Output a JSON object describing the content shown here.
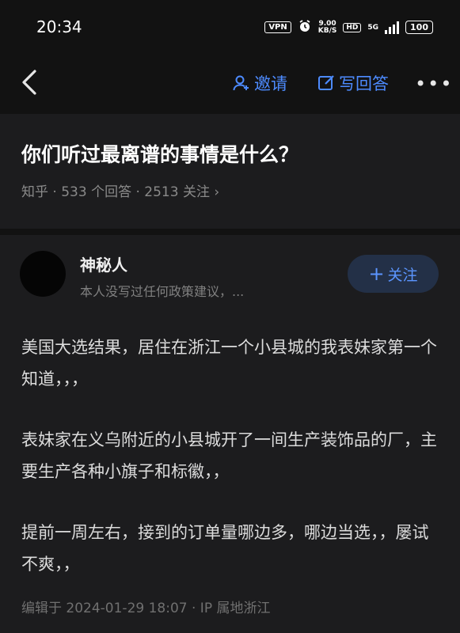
{
  "status_bar": {
    "time": "20:34",
    "vpn": "VPN",
    "speed_value": "9.00",
    "speed_unit": "KB/S",
    "hd": "HD",
    "network": "5G",
    "battery": "100"
  },
  "nav": {
    "invite_label": "邀请",
    "write_answer_label": "写回答",
    "more_label": "•••"
  },
  "question": {
    "title": "你们听过最离谱的事情是什么？",
    "meta": "知乎 · 533 个回答 · 2513 关注 ›"
  },
  "answer": {
    "author_name": "神秘人",
    "author_bio": "本人没写过任何政策建议，...",
    "follow_label": "关注",
    "paragraphs": [
      "美国大选结果，居住在浙江一个小县城的我表妹家第一个知道，，，",
      "表妹家在义乌附近的小县城开了一间生产装饰品的厂，主要生产各种小旗子和标徽，，",
      "提前一周左右，接到的订单量哪边多，哪边当选，，屡试不爽，，"
    ],
    "edit_info": "编辑于 2024-01-29 18:07 · IP 属地浙江"
  },
  "colors": {
    "background": "#121212",
    "card": "#1c1c1e",
    "accent": "#4d8bff",
    "follow_bg": "#233047"
  }
}
